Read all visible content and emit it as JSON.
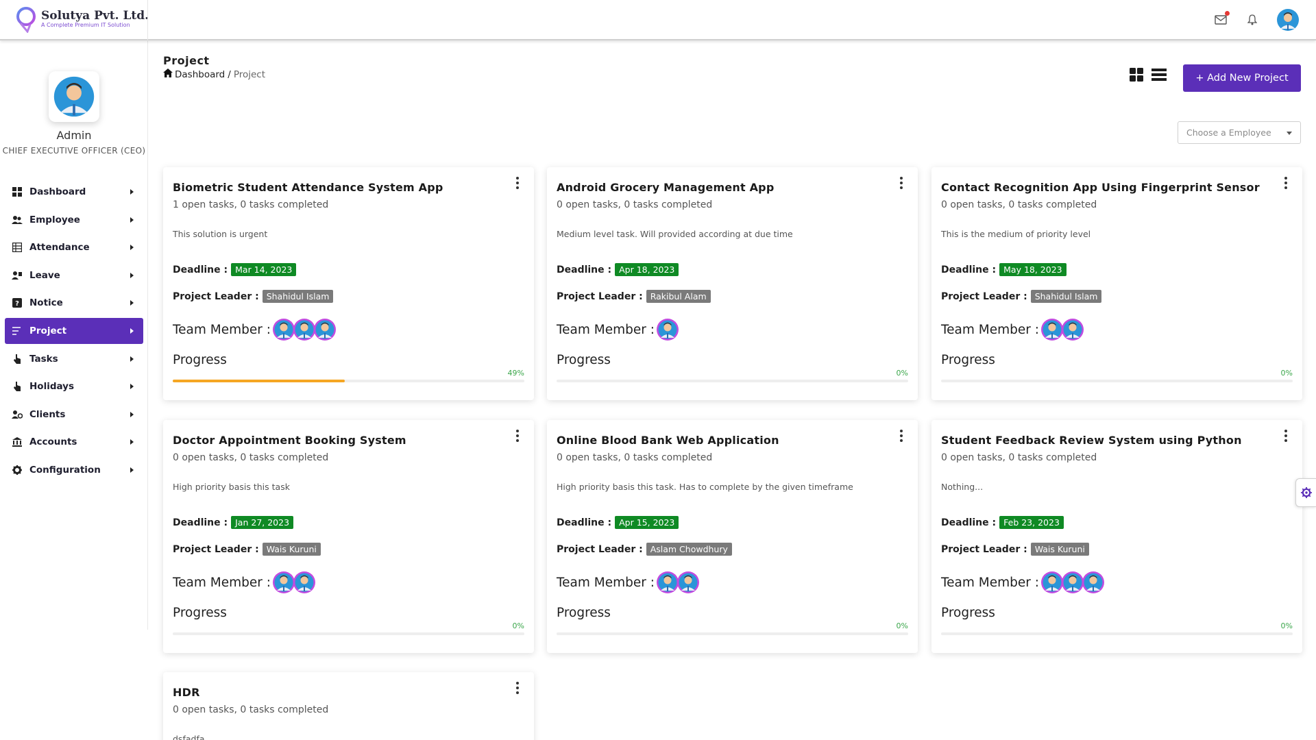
{
  "brand": {
    "name": "Solutya Pvt. Ltd.",
    "tagline": "A Complete Premium IT Solution"
  },
  "header": {
    "icons": [
      "mail-icon",
      "bell-icon",
      "user-avatar"
    ]
  },
  "profile": {
    "name": "Admin",
    "role": "CHIEF EXECUTIVE OFFICER (CEO)"
  },
  "sidebar": {
    "items": [
      {
        "label": "Dashboard",
        "icon": "grid-icon"
      },
      {
        "label": "Employee",
        "icon": "people-icon"
      },
      {
        "label": "Attendance",
        "icon": "table-icon"
      },
      {
        "label": "Leave",
        "icon": "leave-icon"
      },
      {
        "label": "Notice",
        "icon": "question-icon"
      },
      {
        "label": "Project",
        "icon": "bars-icon",
        "active": true
      },
      {
        "label": "Tasks",
        "icon": "hand-icon"
      },
      {
        "label": "Holidays",
        "icon": "hand-icon"
      },
      {
        "label": "Clients",
        "icon": "people-cog-icon"
      },
      {
        "label": "Accounts",
        "icon": "bank-icon"
      },
      {
        "label": "Configuration",
        "icon": "gear-icon"
      }
    ]
  },
  "page": {
    "title": "Project",
    "breadcrumb": {
      "home": "Dashboard",
      "separator": "/",
      "current": "Project"
    },
    "add_button": "+ Add New Project",
    "employee_select_placeholder": "Choose a Employee"
  },
  "labels": {
    "deadline": "Deadline :",
    "leader": "Project Leader :",
    "team": "Team Member :",
    "progress": "Progress"
  },
  "colors": {
    "accent": "#5b2fb8",
    "deadline_badge": "#0f8a24",
    "leader_badge": "#7a7a7a",
    "progress_bar": "#f5a623",
    "percent_text": "#3aa64a"
  },
  "projects": [
    {
      "title": "Biometric Student Attendance System App",
      "tasks": "1 open tasks, 0 tasks completed",
      "description": "This solution is urgent",
      "deadline": "Mar 14, 2023",
      "leader": "Shahidul Islam",
      "team_count": 3,
      "progress_label": "49%",
      "progress": 0.49
    },
    {
      "title": "Android Grocery Management App",
      "tasks": "0 open tasks, 0 tasks completed",
      "description": "Medium level task. Will provided according at due time",
      "deadline": "Apr 18, 2023",
      "leader": "Rakibul Alam",
      "team_count": 1,
      "progress_label": "0%",
      "progress": 0
    },
    {
      "title": "Contact Recognition App Using Fingerprint Sensor",
      "tasks": "0 open tasks, 0 tasks completed",
      "description": "This is the medium of priority level",
      "deadline": "May 18, 2023",
      "leader": "Shahidul Islam",
      "team_count": 2,
      "progress_label": "0%",
      "progress": 0
    },
    {
      "title": "Doctor Appointment Booking System",
      "tasks": "0 open tasks, 0 tasks completed",
      "description": "High priority basis this task",
      "deadline": "Jan 27, 2023",
      "leader": "Wais Kuruni",
      "team_count": 2,
      "progress_label": "0%",
      "progress": 0
    },
    {
      "title": "Online Blood Bank Web Application",
      "tasks": "0 open tasks, 0 tasks completed",
      "description": "High priority basis this task. Has to complete by the given timeframe",
      "deadline": "Apr 15, 2023",
      "leader": "Aslam Chowdhury",
      "team_count": 2,
      "progress_label": "0%",
      "progress": 0
    },
    {
      "title": "Student Feedback Review System using Python",
      "tasks": "0 open tasks, 0 tasks completed",
      "description": "Nothing...",
      "deadline": "Feb 23, 2023",
      "leader": "Wais Kuruni",
      "team_count": 3,
      "progress_label": "0%",
      "progress": 0
    },
    {
      "title": "HDR",
      "tasks": "0 open tasks, 0 tasks completed",
      "description": "dsfadfa",
      "deadline": "",
      "leader": "",
      "team_count": 0,
      "progress_label": "",
      "progress": 0
    }
  ]
}
